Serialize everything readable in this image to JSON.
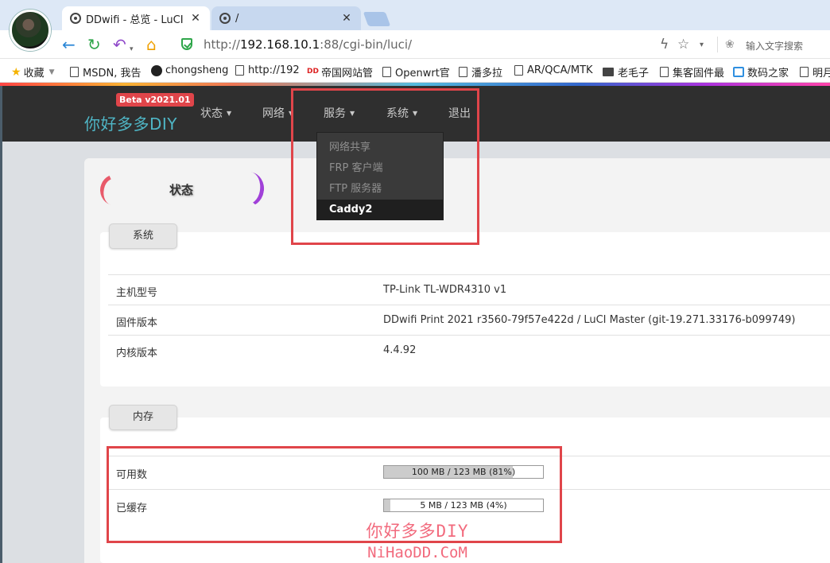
{
  "browser": {
    "tabs": [
      {
        "title": "DDwifi - 总览 - LuCI",
        "close": "✕"
      },
      {
        "title": "/",
        "close": "✕"
      }
    ],
    "url_prefix": "http://",
    "url_host": "192.168.10.1",
    "url_rest": ":88/cgi-bin/luci/",
    "search_placeholder": "输入文字搜索",
    "bookmarks": [
      "收藏",
      "MSDN, 我告",
      "chongsheng",
      "http://192",
      "帝国网站管",
      "Openwrt官",
      "潘多拉",
      "AR/QCA/MTK",
      "老毛子",
      "集客固件最",
      "数码之家",
      "明月"
    ],
    "bookmark_dd_mark": "DD\nwifi"
  },
  "luci": {
    "brand": "你好多多DIY",
    "beta_badge": "Beta v2021.01",
    "menu": {
      "status": "状态",
      "network": "网络",
      "services": "服务",
      "system": "系统",
      "logout": "退出"
    },
    "services_dropdown": [
      "网络共享",
      "FRP 客户端",
      "FTP 服务器",
      "Caddy2"
    ],
    "page_title": "状态",
    "system_section": {
      "tab": "系统",
      "rows": [
        {
          "label": "主机型号",
          "value": "TP-Link TL-WDR4310 v1"
        },
        {
          "label": "固件版本",
          "value": "DDwifi Print 2021 r3560-79f57e422d / LuCI Master (git-19.271.33176-b099749)"
        },
        {
          "label": "内核版本",
          "value": "4.4.92"
        }
      ]
    },
    "memory_section": {
      "tab": "内存",
      "rows": [
        {
          "label": "可用数",
          "bar_text": "100 MB / 123 MB (81%)",
          "percent": 81
        },
        {
          "label": "已缓存",
          "bar_text": "5 MB / 123 MB (4%)",
          "percent": 4
        }
      ]
    },
    "watermark": {
      "line1": "你好多多DIY",
      "line2": "NiHaoDD.CoM"
    }
  },
  "colors": {
    "highlight": "#e0454a",
    "brand": "#4fb6c6",
    "beta_bg": "#e0454a",
    "nav_bg": "#2f2f2f"
  }
}
